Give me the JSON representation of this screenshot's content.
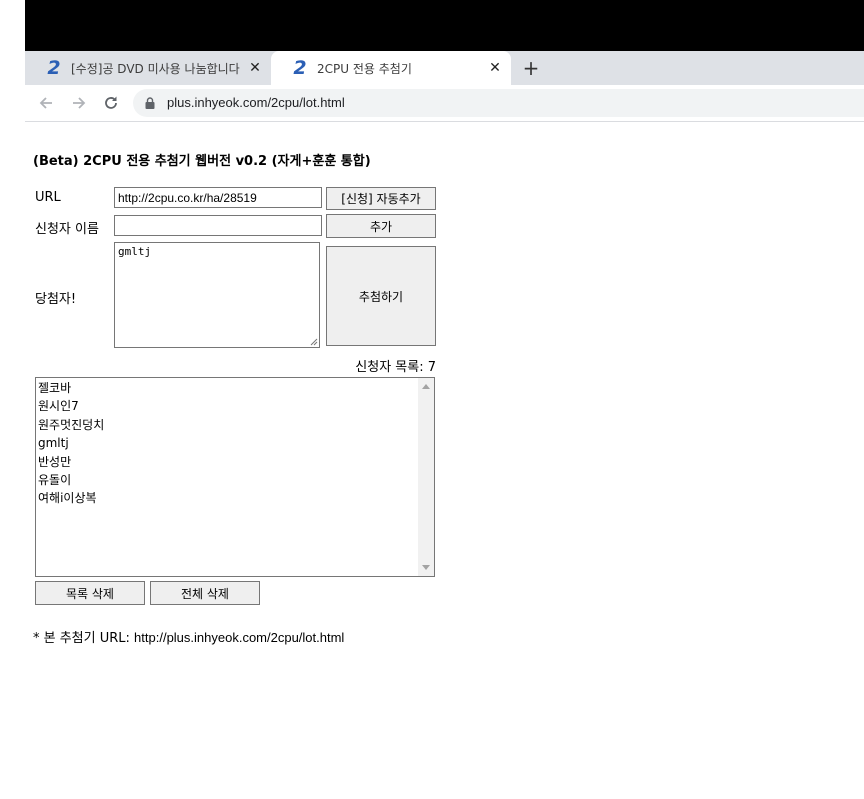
{
  "browser": {
    "tabs": [
      {
        "title": "[수정]공 DVD 미사용 나눔합니다",
        "favicon": "2",
        "active": false,
        "close": "✕"
      },
      {
        "title": "2CPU 전용 추첨기",
        "favicon": "2",
        "active": true,
        "close": "✕"
      }
    ],
    "new_tab": "+",
    "address": "plus.inhyeok.com/2cpu/lot.html"
  },
  "page": {
    "title": "(Beta) 2CPU 전용 추첨기 웹버전 v0.2 (자게+훈훈 통합)",
    "url_label": "URL",
    "url_value": "http://2cpu.co.kr/ha/28519",
    "auto_add_button": "[신청] 자동추가",
    "applicant_label": "신청자 이름",
    "applicant_value": "",
    "add_button": "추가",
    "winner_label": "당첨자!",
    "winner_value": "gmltj",
    "draw_button": "추첨하기",
    "list_count_label": "신청자 목록: 7",
    "applicants": [
      "젤코바",
      "원시인7",
      "원주멋진덩치",
      "gmltj",
      "반성만",
      "유돌이",
      "여해i이상복"
    ],
    "delete_item_button": "목록 삭제",
    "delete_all_button": "전체 삭제",
    "footer_prefix": "* 본 추첨기 URL: ",
    "footer_url": "http://plus.inhyeok.com/2cpu/lot.html"
  }
}
